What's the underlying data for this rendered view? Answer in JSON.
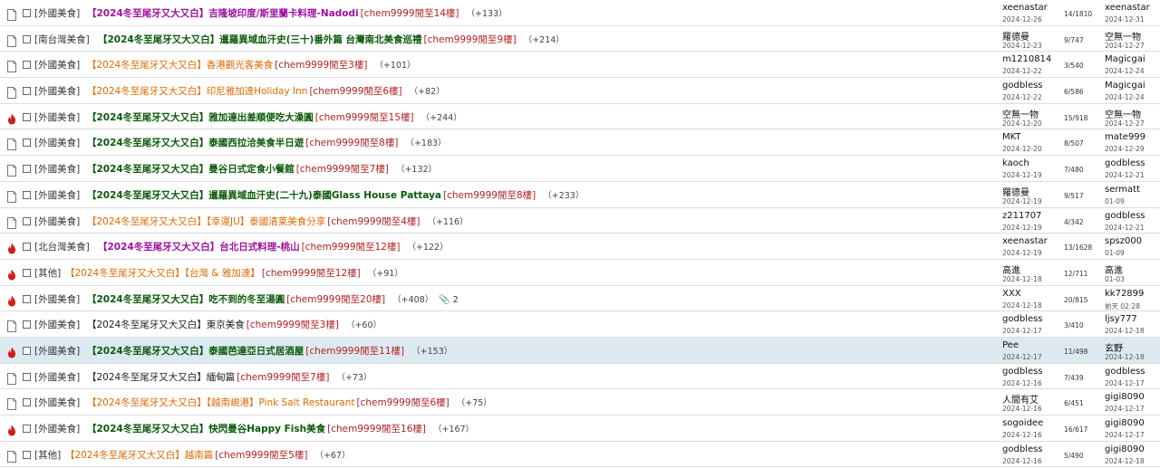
{
  "threads": [
    {
      "icon": "doc",
      "category": "[外國美食]",
      "title": "【2024冬至尾牙又大又白】吉隆坡印度/斯里蘭卡料理-Nadodi",
      "title_color": "purple",
      "pages": "[chem9999閒至14樓]",
      "count": "（+133）",
      "author": "xeenastar",
      "author_date": "2024-12-26",
      "stats": "14/1810",
      "last_user": "xeenastar",
      "last_date": "2024-12-31"
    },
    {
      "icon": "doc",
      "category": "[南台灣美食]",
      "title": "【2024冬至尾牙又大又白】暹羅異域血汗史(三十)番外篇 台灣南北美食巡禮",
      "title_color": "green",
      "pages": "[chem9999閒至9樓]",
      "count": "（+214）",
      "author": "羅德曼",
      "author_date": "2024-12-23",
      "stats": "9/747",
      "last_user": "空無一物",
      "last_date": "2024-12-27"
    },
    {
      "icon": "doc",
      "category": "[外國美食]",
      "title": "【2024冬至尾牙又大又白】香港觀光客美食",
      "title_color": "orange",
      "pages": "[chem9999閒至3樓]",
      "count": "（+101）",
      "author": "m1210814",
      "author_date": "2024-12-22",
      "stats": "3/540",
      "last_user": "Magicgai",
      "last_date": "2024-12-24"
    },
    {
      "icon": "doc",
      "category": "[外國美食]",
      "title": "【2024冬至尾牙又大又白】印尼雅加達Holiday Inn",
      "title_color": "orange",
      "pages": "[chem9999閒至6樓]",
      "count": "（+82）",
      "author": "godbless",
      "author_date": "2024-12-22",
      "stats": "6/586",
      "last_user": "Magicgai",
      "last_date": "2024-12-24"
    },
    {
      "icon": "hot",
      "category": "[外國美食]",
      "title": "【2024冬至尾牙又大又白】雅加達出差順便吃大澡圓",
      "title_color": "green",
      "pages": "[chem9999閒至15樓]",
      "count": "（+244）",
      "author": "空無一物",
      "author_date": "2024-12-20",
      "stats": "15/918",
      "last_user": "空無一物",
      "last_date": "2024-12-27"
    },
    {
      "icon": "doc",
      "category": "[外國美食]",
      "title": "【2024冬至尾牙又大又白】泰國西拉洽美食半日遊",
      "title_color": "green",
      "pages": "[chem9999閒至8樓]",
      "count": "（+183）",
      "author": "MKT",
      "author_date": "2024-12-20",
      "stats": "8/507",
      "last_user": "mate999",
      "last_date": "2024-12-29"
    },
    {
      "icon": "doc",
      "category": "[外國美食]",
      "title": "【2024冬至尾牙又大又白】曼谷日式定食小餐館",
      "title_color": "green",
      "pages": "[chem9999閒至7樓]",
      "count": "（+132）",
      "author": "kaoch",
      "author_date": "2024-12-19",
      "stats": "7/480",
      "last_user": "godbless",
      "last_date": "2024-12-21"
    },
    {
      "icon": "doc",
      "category": "[外國美食]",
      "title": "【2024冬至尾牙又大又白】暹羅異域血汗史(二十九)泰國Glass House Pattaya",
      "title_color": "green",
      "pages": "[chem9999閒至8樓]",
      "count": "（+233）",
      "author": "羅德曼",
      "author_date": "2024-12-19",
      "stats": "9/517",
      "last_user": "sermatt",
      "last_date": "01-09"
    },
    {
      "icon": "doc",
      "category": "[外國美食]",
      "title": "【2024冬至尾牙又大又白】【幸運JU】泰國清萊美食分享",
      "title_color": "orange",
      "pages": "[chem9999閒至4樓]",
      "count": "（+116）",
      "author": "z211707",
      "author_date": "2024-12-19",
      "stats": "4/342",
      "last_user": "godbless",
      "last_date": "2024-12-21"
    },
    {
      "icon": "hot",
      "category": "[北台灣美食]",
      "title": "【2024冬至尾牙又大又白】台北日式料理-桃山",
      "title_color": "purple",
      "pages": "[chem9999閒至12樓]",
      "count": "（+122）",
      "author": "xeenastar",
      "author_date": "2024-12-19",
      "stats": "13/1628",
      "last_user": "spsz000",
      "last_date": "01-09"
    },
    {
      "icon": "hot",
      "category": "[其他]",
      "title": "【2024冬至尾牙又大又白】【台灣 & 雅加達】",
      "title_color": "orange",
      "pages": "[chem9999閒至12樓]",
      "count": "（+91）",
      "author": "高進",
      "author_date": "2024-12-18",
      "stats": "12/711",
      "last_user": "高進",
      "last_date": "01-03"
    },
    {
      "icon": "hot",
      "category": "[外國美食]",
      "title": "【2024冬至尾牙又大又白】吃不到的冬至湯圓",
      "title_color": "green",
      "pages": "[chem9999閒至20樓]",
      "count": "（+408）",
      "clip": "📎",
      "clip_num": "2",
      "author": "XXX",
      "author_date": "2024-12-18",
      "stats": "20/815",
      "last_user": "kk72899",
      "last_date": "前天 02:28"
    },
    {
      "icon": "doc",
      "category": "[外國美食]",
      "title": "【2024冬至尾牙又大又白】東京美食",
      "title_color": "dark",
      "pages": "[chem9999閒至3樓]",
      "count": "（+60）",
      "author": "godbless",
      "author_date": "2024-12-17",
      "stats": "3/410",
      "last_user": "ljsy777",
      "last_date": "2024-12-18"
    },
    {
      "icon": "hot",
      "category": "[外國美食]",
      "title": "【2024冬至尾牙又大又白】泰國芭達亞日式居酒屋",
      "title_color": "green",
      "pages": "[chem9999閒至11樓]",
      "count": "（+153）",
      "author": "Pee",
      "author_date": "2024-12-17",
      "stats": "11/498",
      "last_user": "玄野",
      "last_date": "2024-12-18",
      "highlight": true
    },
    {
      "icon": "doc",
      "category": "[外國美食]",
      "title": "【2024冬至尾牙又大又白】緬甸篇",
      "title_color": "dark",
      "pages": "[chem9999閒至7樓]",
      "count": "（+73）",
      "author": "godbless",
      "author_date": "2024-12-16",
      "stats": "7/439",
      "last_user": "godbless",
      "last_date": "2024-12-17"
    },
    {
      "icon": "doc",
      "category": "[外國美食]",
      "title": "【2024冬至尾牙又大又白】【越南峴港】Pink Salt Restaurant",
      "title_color": "orange",
      "pages": "[chem9999閒至6樓]",
      "count": "（+75）",
      "author": "人間有艾",
      "author_date": "2024-12-16",
      "stats": "6/451",
      "last_user": "gigi8090",
      "last_date": "2024-12-17"
    },
    {
      "icon": "hot",
      "category": "[外國美食]",
      "title": "【2024冬至尾牙又大又白】快閃曼谷Happy Fish美食",
      "title_color": "green",
      "pages": "[chem9999閒至16樓]",
      "count": "（+167）",
      "author": "sogoidee",
      "author_date": "2024-12-16",
      "stats": "16/617",
      "last_user": "gigi8090",
      "last_date": "2024-12-17"
    },
    {
      "icon": "doc",
      "category": "[其他]",
      "title": "【2024冬至尾牙又大又白】越南篇",
      "title_color": "orange",
      "pages": "[chem9999閒至5樓]",
      "count": "（+67）",
      "author": "godbless",
      "author_date": "2024-12-16",
      "stats": "5/490",
      "last_user": "gigi8090",
      "last_date": "2024-12-18"
    }
  ],
  "colors": {
    "purple": "#a010a0",
    "green": "#0a5a0a",
    "orange": "#e06a00",
    "dark": "#222222",
    "highlight_bg": "#dde9f0"
  }
}
